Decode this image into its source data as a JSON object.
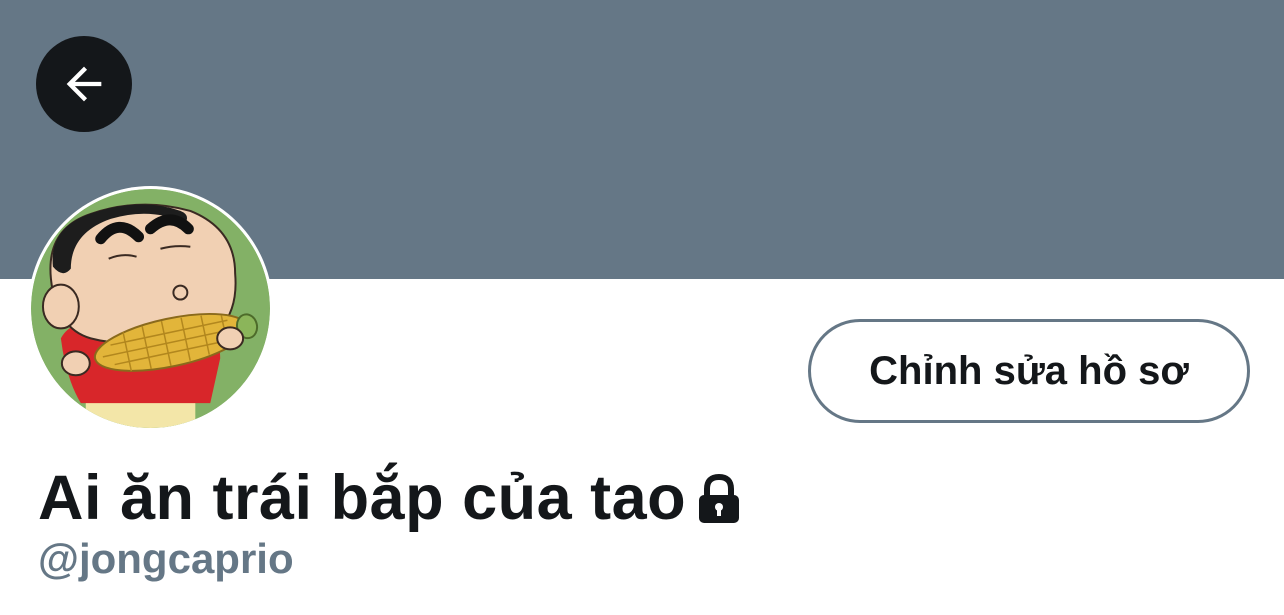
{
  "colors": {
    "banner": "#657786",
    "back_button_bg": "#14171a",
    "text_primary": "#14171a",
    "text_secondary": "#657786",
    "button_border": "#657786",
    "background": "#ffffff"
  },
  "header": {
    "back_icon": "arrow-left-icon"
  },
  "profile": {
    "avatar": "cartoon-boy-eating-corn-avatar",
    "edit_button_label": "Chỉnh sửa hồ sơ",
    "display_name": "Ai ăn trái bắp của tao",
    "protected_icon": "lock-icon",
    "handle": "@jongcaprio"
  }
}
